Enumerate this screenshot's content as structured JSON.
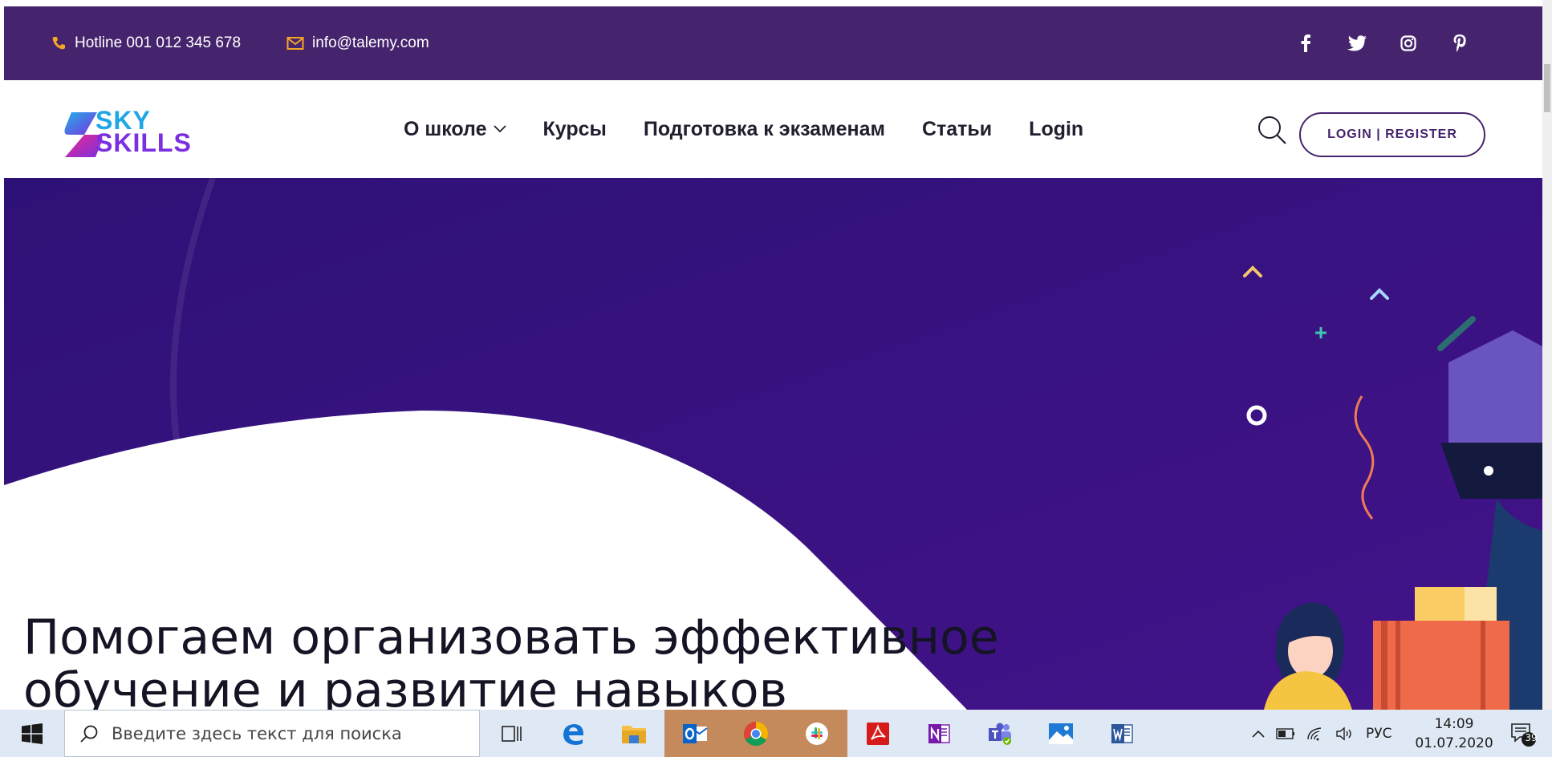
{
  "topbar": {
    "hotline": "Hotline 001 012 345 678",
    "email": "info@talemy.com",
    "socials": [
      "facebook-icon",
      "twitter-icon",
      "instagram-icon",
      "pinterest-icon"
    ]
  },
  "header": {
    "logo_top": "SKY",
    "logo_bottom": "SKILLS",
    "nav": [
      {
        "label": "О школе"
      },
      {
        "label": "Курсы"
      },
      {
        "label": "Подготовка к экзаменам"
      },
      {
        "label": "Статьи"
      },
      {
        "label": "Login"
      }
    ],
    "login_register": "LOGIN | REGISTER"
  },
  "hero": {
    "headline_line1": "Помогаем организовать эффективное",
    "headline_line2": "обучение и развитие навыков"
  },
  "taskbar": {
    "search_placeholder": "Введите здесь текст для поиска",
    "apps": [
      "task-view-icon",
      "edge-icon",
      "file-explorer-icon",
      "outlook-icon",
      "chrome-icon",
      "slack-icon",
      "acrobat-icon",
      "onenote-icon",
      "teams-icon",
      "photos-icon",
      "word-icon"
    ],
    "language": "РУС",
    "time": "14:09",
    "date": "01.07.2020",
    "notification_count": "39"
  },
  "colors": {
    "topbar": "#46246d",
    "hero": "#3a1283",
    "accent_orange": "#f5a623"
  }
}
